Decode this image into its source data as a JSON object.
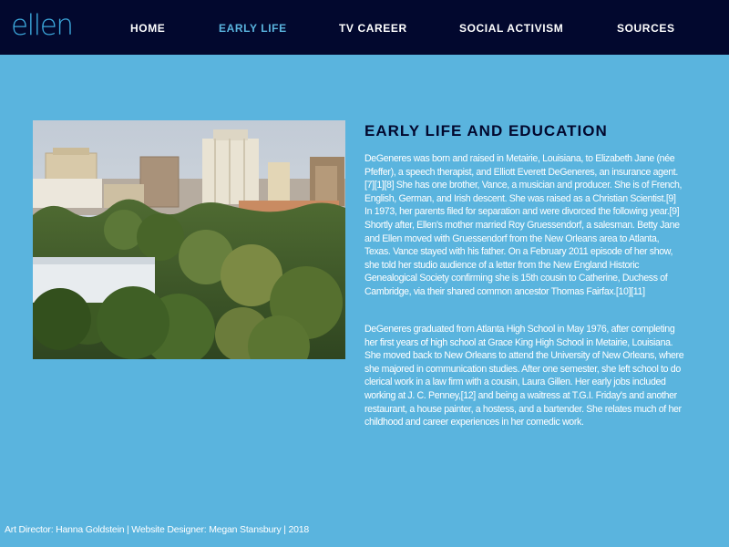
{
  "header": {
    "logo_text": "ellen",
    "nav": [
      {
        "label": "HOME"
      },
      {
        "label": "EARLY LIFE",
        "active": true
      },
      {
        "label": "TV CAREER"
      },
      {
        "label": "SOCIAL ACTIVISM"
      },
      {
        "label": "SOURCES"
      }
    ]
  },
  "main": {
    "title": "EARLY LIFE AND EDUCATION",
    "paragraphs": [
      "DeGeneres was born and raised in Metairie, Louisiana, to Elizabeth Jane (née Pfeffer), a speech therapist, and Elliott Everett DeGeneres, an insurance agent.[7][1][8] She has one brother, Vance, a musician and producer. She is of French, English, German, and Irish descent. She was raised as a Christian Scientist.[9] In 1973, her parents filed for separation and were divorced the following year.[9] Shortly after, Ellen's mother married Roy Gruessendorf, a salesman. Betty Jane and Ellen moved with Gruessendorf from the New Orleans area to Atlanta, Texas. Vance stayed with his father. On a February 2011 episode of her show, she told her studio audience of a letter from the New England Historic Genealogical Society confirming she is 15th cousin to Catherine, Duchess of Cambridge, via their shared common ancestor Thomas Fairfax.[10][11]",
      "DeGeneres graduated from Atlanta High School in May 1976, after completing her first years of high school at Grace King High School in Metairie, Louisiana. She moved back to New Orleans to attend the University of New Orleans, where she majored in communication studies. After one semester, she left school to do clerical work in a law firm with a cousin, Laura Gillen. Her early jobs included working at J. C. Penney,[12] and being a waitress at T.G.I. Friday's and another restaurant, a house painter, a hostess, and a bartender. She relates much of her childhood and career experiences in her comedic work."
    ]
  },
  "footer": {
    "credits": "Art Director: Hanna Goldstein | Website Designer: Megan Stansbury | 2018"
  },
  "colors": {
    "background": "#5ab4de",
    "navbar": "#02082e",
    "logo": "#3ca8dc",
    "nav_active": "#5ab4de",
    "title": "#02082e"
  }
}
